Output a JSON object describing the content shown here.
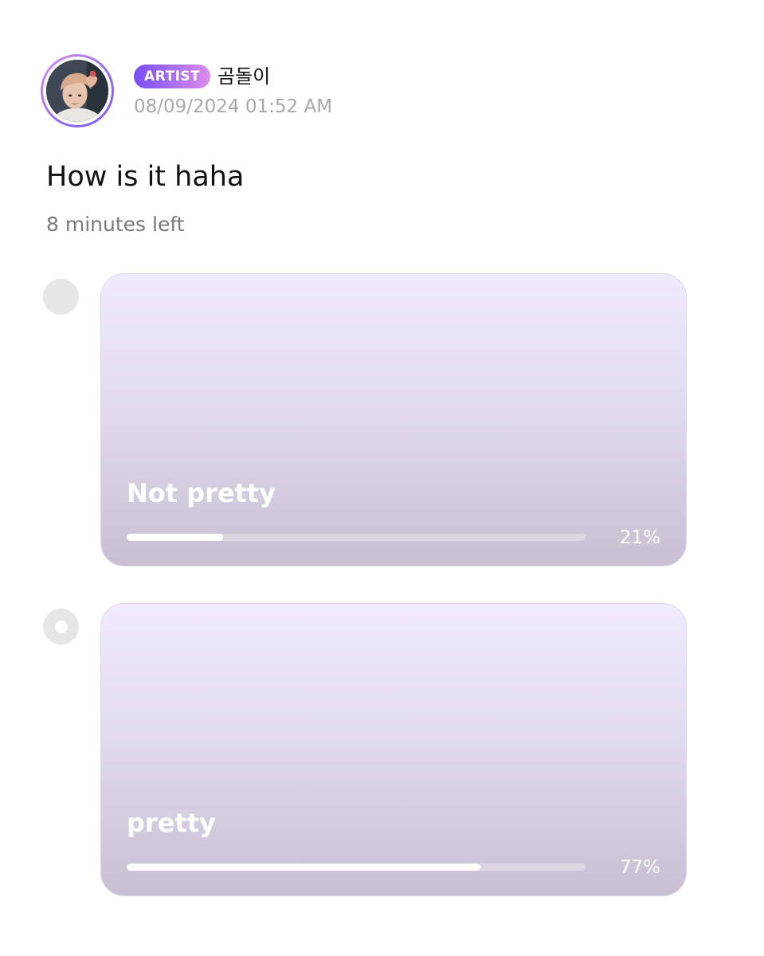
{
  "post": {
    "badge": "ARTIST",
    "author": "곰돌이",
    "timestamp": "08/09/2024 01:52 AM",
    "question": "How is it haha",
    "time_left": "8 minutes left"
  },
  "poll": {
    "options": [
      {
        "label": "Not pretty",
        "percent_text": "21%",
        "fill_fraction": 0.21,
        "selected": false
      },
      {
        "label": "pretty",
        "percent_text": "77%",
        "fill_fraction": 0.77,
        "selected": true
      }
    ]
  },
  "colors": {
    "badge_gradient": [
      "#7a4df5",
      "#de8cea"
    ],
    "card_gradient": [
      "#f1eafc",
      "#c8c0d2"
    ],
    "bar_fill": "#ffffff",
    "radio": "#e6e6e6"
  },
  "icons": {
    "avatar": "profile-photo",
    "radio_unselected": "radio-empty-icon",
    "radio_selected": "radio-selected-icon"
  }
}
